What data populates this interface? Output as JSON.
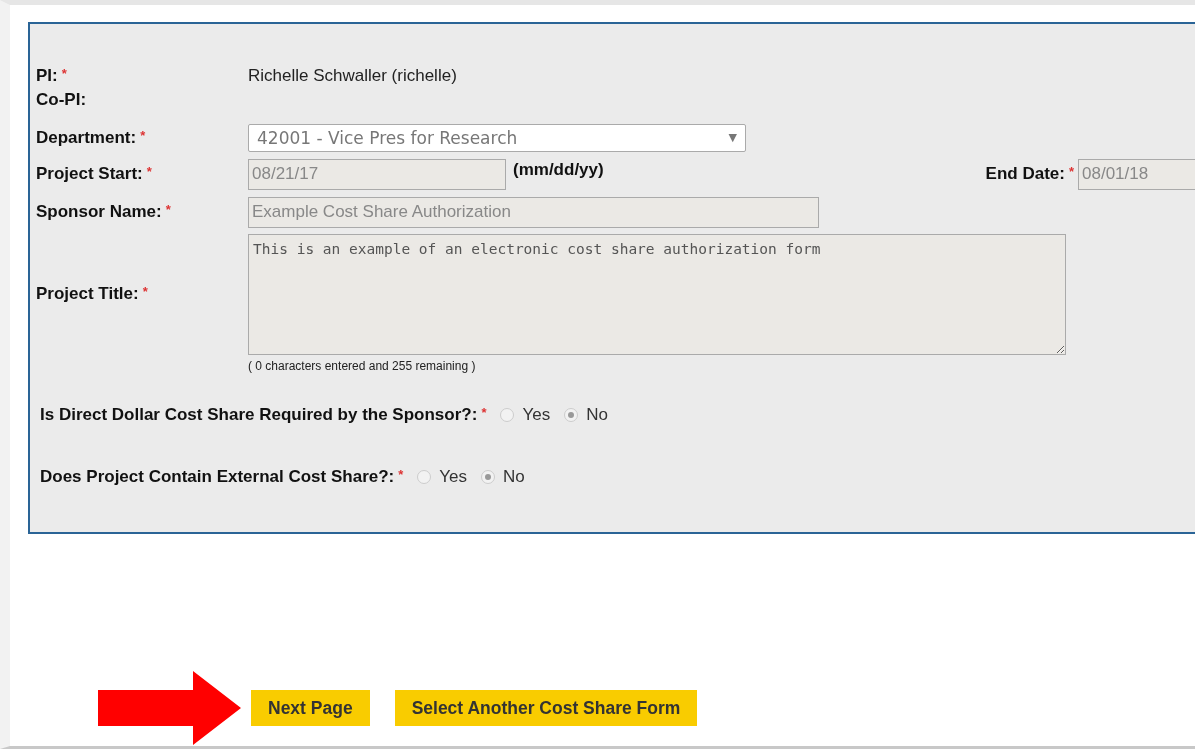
{
  "form": {
    "pi": {
      "label": "PI:",
      "required": "*",
      "value": "Richelle Schwaller (richelle)"
    },
    "co_pi": {
      "label": "Co-PI:"
    },
    "department": {
      "label": "Department:",
      "required": "*",
      "value": "42001 - Vice Pres for Research",
      "arrow": "▼"
    },
    "project_start": {
      "label": "Project Start:",
      "required": "*",
      "value": "08/21/17",
      "hint": "(mm/dd/yy)"
    },
    "end_date": {
      "label": "End Date:",
      "required": "*",
      "value": "08/01/18"
    },
    "sponsor_name": {
      "label": "Sponsor Name:",
      "required": "*",
      "value": "Example Cost Share Authorization"
    },
    "project_title": {
      "label": "Project Title:",
      "required": "*",
      "value": "This is an example of an electronic cost share authorization form",
      "counter": "( 0 characters entered and 255 remaining )"
    },
    "questions": [
      {
        "label": "Is Direct Dollar Cost Share Required by the Sponsor?:",
        "required": "*",
        "options": [
          {
            "label": "Yes",
            "selected": false
          },
          {
            "label": "No",
            "selected": true
          }
        ]
      },
      {
        "label": "Does Project Contain External Cost Share?:",
        "required": "*",
        "options": [
          {
            "label": "Yes",
            "selected": false
          },
          {
            "label": "No",
            "selected": true
          }
        ]
      }
    ]
  },
  "buttons": [
    "Next Page",
    "Select Another Cost Share Form"
  ]
}
